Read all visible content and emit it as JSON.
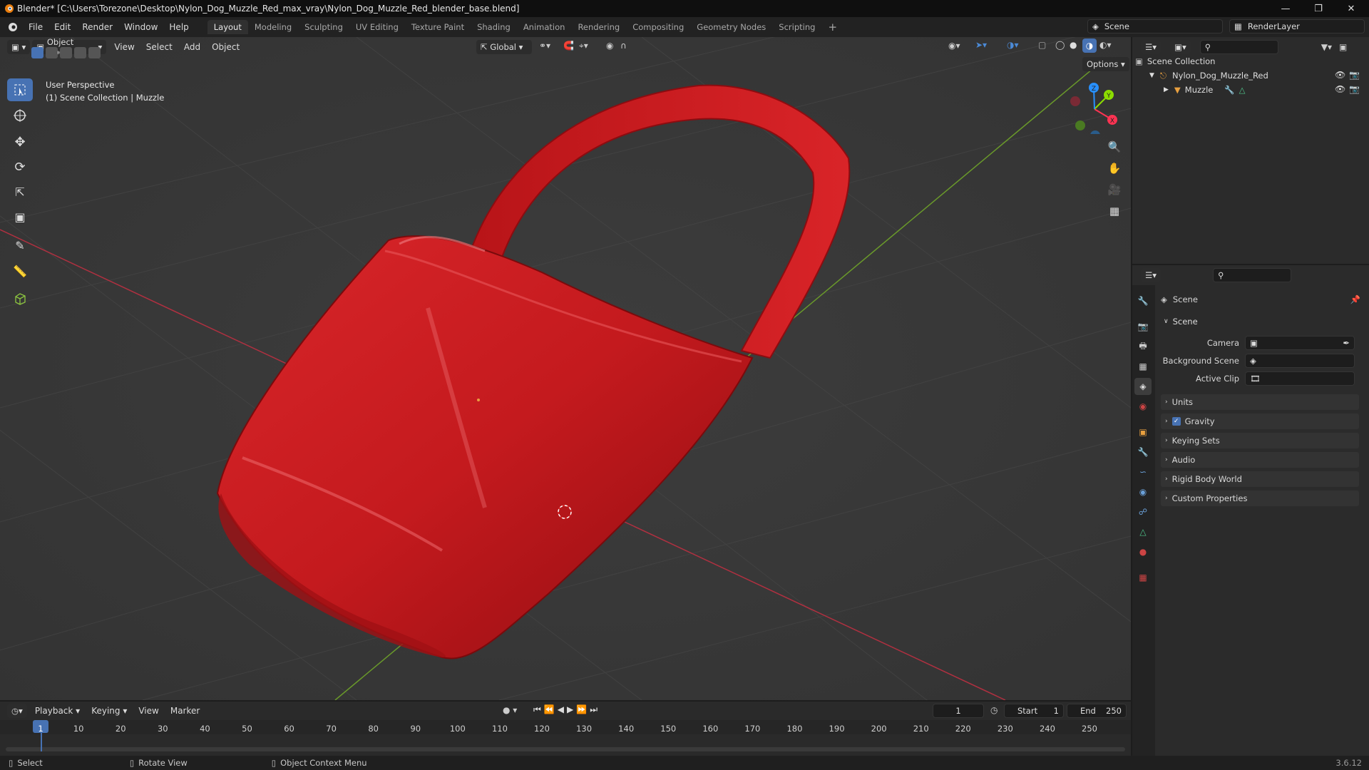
{
  "app": {
    "title": "Blender* [C:\\Users\\Torezone\\Desktop\\Nylon_Dog_Muzzle_Red_max_vray\\Nylon_Dog_Muzzle_Red_blender_base.blend]",
    "version": "3.6.12"
  },
  "menus": [
    "File",
    "Edit",
    "Render",
    "Window",
    "Help"
  ],
  "workspaces": [
    "Layout",
    "Modeling",
    "Sculpting",
    "UV Editing",
    "Texture Paint",
    "Shading",
    "Animation",
    "Rendering",
    "Compositing",
    "Geometry Nodes",
    "Scripting"
  ],
  "active_workspace": "Layout",
  "scene_field": "Scene",
  "renderlayer_field": "RenderLayer",
  "viewport": {
    "mode": "Object Mode",
    "menu": [
      "View",
      "Select",
      "Add",
      "Object"
    ],
    "transform_orientation": "Global",
    "options_label": "Options",
    "overlay_line1": "User Perspective",
    "overlay_line2": "(1) Scene Collection | Muzzle",
    "gizmo": {
      "x": "X",
      "y": "Y",
      "z": "Z"
    }
  },
  "outliner": {
    "root": "Scene Collection",
    "items": [
      {
        "label": "Nylon_Dog_Muzzle_Red"
      },
      {
        "label": "Muzzle"
      }
    ]
  },
  "properties": {
    "header": "Scene",
    "section_open": "Scene",
    "fields": [
      {
        "label": "Camera",
        "value": ""
      },
      {
        "label": "Background Scene",
        "value": ""
      },
      {
        "label": "Active Clip",
        "value": ""
      }
    ],
    "sections": [
      "Units",
      "Gravity",
      "Keying Sets",
      "Audio",
      "Rigid Body World",
      "Custom Properties"
    ],
    "gravity_checked": true
  },
  "timeline": {
    "menus": [
      "Playback",
      "Keying",
      "View",
      "Marker"
    ],
    "current_frame": "1",
    "start_label": "Start",
    "start": "1",
    "end_label": "End",
    "end": "250",
    "ruler": [
      "1",
      "10",
      "20",
      "30",
      "40",
      "50",
      "60",
      "70",
      "80",
      "90",
      "100",
      "110",
      "120",
      "130",
      "140",
      "150",
      "160",
      "170",
      "180",
      "190",
      "200",
      "210",
      "220",
      "230",
      "240",
      "250"
    ]
  },
  "status_bar": {
    "select": "Select",
    "rotate": "Rotate View",
    "context": "Object Context Menu"
  },
  "colors": {
    "accent": "#4772b3",
    "muzzle": "#c8191d",
    "x_axis": "#ff3352",
    "y_axis": "#8bdc00",
    "z_axis": "#2890ff"
  }
}
